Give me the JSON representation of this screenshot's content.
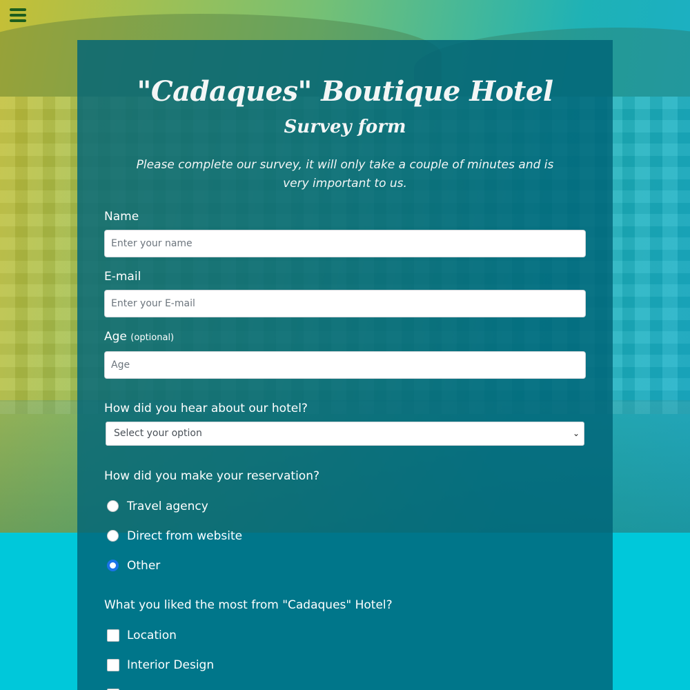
{
  "menu": {
    "icon": "hamburger-icon"
  },
  "header": {
    "title": "\"Cadaques\" Boutique Hotel",
    "subtitle": "Survey form",
    "description": "Please complete our survey, it will only take a couple of minutes and is very important to us."
  },
  "form": {
    "name": {
      "label": "Name",
      "placeholder": "Enter your name"
    },
    "email": {
      "label": "E-mail",
      "placeholder": "Enter your E-mail"
    },
    "age": {
      "label": "Age",
      "note": "(optional)",
      "placeholder": "Age"
    },
    "hear": {
      "label": "How did you hear about our hotel?",
      "selected": "Select your option"
    },
    "reservation": {
      "label": "How did you make your reservation?",
      "options": [
        "Travel agency",
        "Direct from website",
        "Other"
      ],
      "selected": "Other"
    },
    "liked": {
      "label": "What you liked the most from \"Cadaques\" Hotel?",
      "options": [
        "Location",
        "Interior Design"
      ]
    }
  },
  "colors": {
    "panel": "#006478",
    "accent": "#1a73e8",
    "menu_icon": "#1c5d1e",
    "page_bottom": "#00c8da"
  }
}
